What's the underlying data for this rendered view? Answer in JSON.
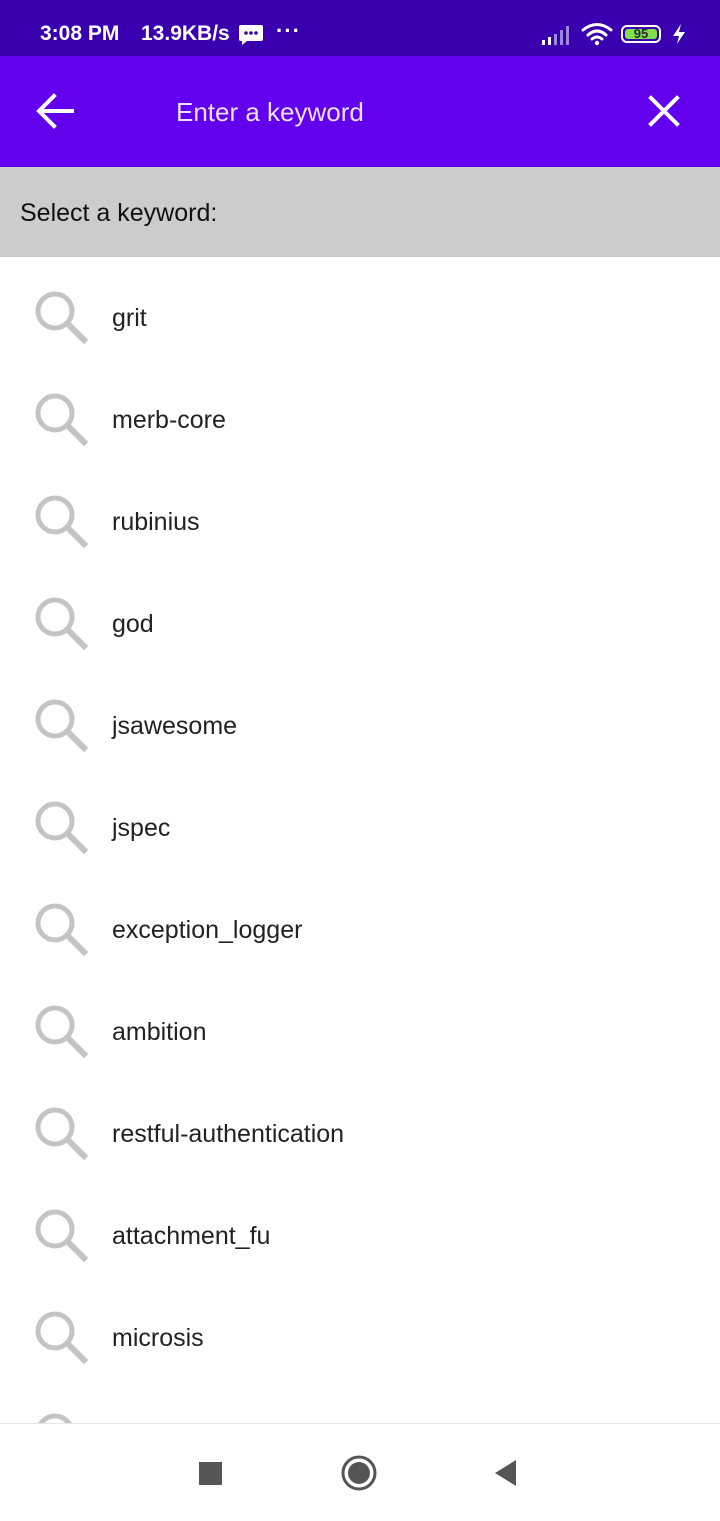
{
  "status_bar": {
    "time": "3:08 PM",
    "net_speed": "13.9KB/s",
    "more": "···",
    "battery": "95"
  },
  "toolbar": {
    "search_placeholder": "Enter a keyword",
    "search_value": "",
    "back_icon": "arrow-left-icon",
    "close_icon": "close-icon"
  },
  "header": {
    "title": "Select a keyword:"
  },
  "keywords": [
    "grit",
    "merb-core",
    "rubinius",
    "god",
    "jsawesome",
    "jspec",
    "exception_logger",
    "ambition",
    "restful-authentication",
    "attachment_fu",
    "microsis",
    ""
  ],
  "colors": {
    "status_bar": "#3a00b0",
    "toolbar": "#6200ee",
    "header": "#cccccc",
    "icon": "#c4c4c4"
  }
}
